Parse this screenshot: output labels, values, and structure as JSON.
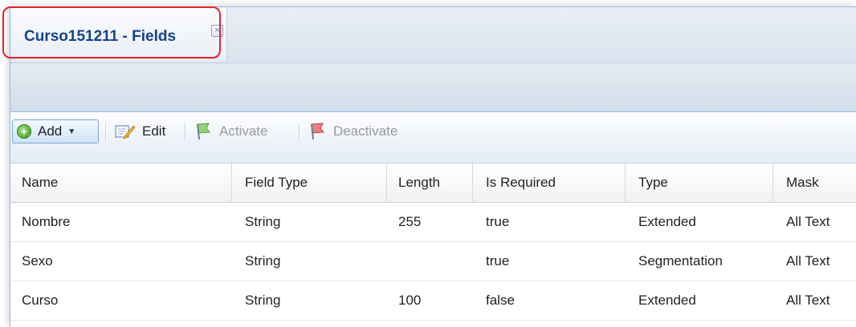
{
  "tab": {
    "title": "Curso151211 - Fields",
    "close_symbol": "×"
  },
  "toolbar": {
    "add_label": "Add",
    "edit_label": "Edit",
    "activate_label": "Activate",
    "deactivate_label": "Deactivate"
  },
  "grid": {
    "columns": [
      "Name",
      "Field Type",
      "Length",
      "Is Required",
      "Type",
      "Mask"
    ],
    "rows": [
      [
        "Nombre",
        "String",
        "255",
        "true",
        "Extended",
        "All Text"
      ],
      [
        "Sexo",
        "String",
        "",
        "true",
        "Segmentation",
        "All Text"
      ],
      [
        "Curso",
        "String",
        "100",
        "false",
        "Extended",
        "All Text"
      ]
    ]
  },
  "colors": {
    "tab_title": "#15428b",
    "highlight": "#e8222a",
    "border": "#99bbe8"
  }
}
